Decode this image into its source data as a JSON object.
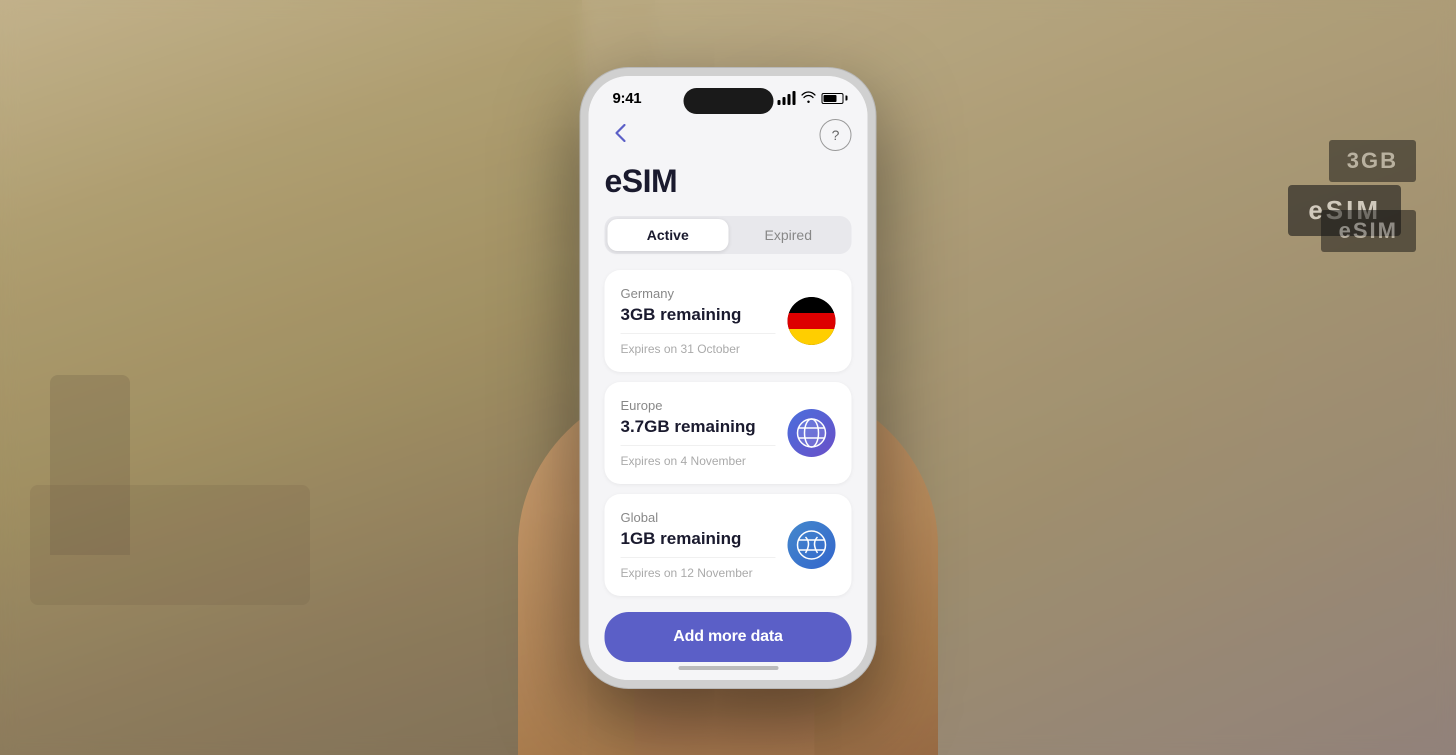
{
  "background": {
    "description": "Blurred airport terminal interior"
  },
  "phone": {
    "status_bar": {
      "time": "9:41",
      "signal_label": "signal",
      "wifi_label": "wifi",
      "battery_label": "battery"
    },
    "header": {
      "back_label": "←",
      "help_label": "?",
      "title": "eSIM"
    },
    "tabs": [
      {
        "label": "Active",
        "active": true
      },
      {
        "label": "Expired",
        "active": false
      }
    ],
    "esim_cards": [
      {
        "region": "Germany",
        "data_remaining": "3GB remaining",
        "expiry": "Expires on 31 October",
        "icon_type": "flag",
        "icon_emoji": "🇩🇪"
      },
      {
        "region": "Europe",
        "data_remaining": "3.7GB remaining",
        "expiry": "Expires on 4 November",
        "icon_type": "globe",
        "icon_color": "blue-purple"
      },
      {
        "region": "Global",
        "data_remaining": "1GB remaining",
        "expiry": "Expires on 12 November",
        "icon_type": "globe",
        "icon_color": "blue"
      }
    ],
    "add_button": {
      "label": "Add more data"
    }
  },
  "colors": {
    "accent": "#5B5FC7",
    "tab_active_bg": "#ffffff",
    "tab_inactive_bg": "transparent",
    "card_bg": "#ffffff",
    "screen_bg": "#f5f5f7",
    "title_color": "#1a1a2e",
    "region_color": "#888888",
    "expiry_color": "#aaaaaa"
  }
}
